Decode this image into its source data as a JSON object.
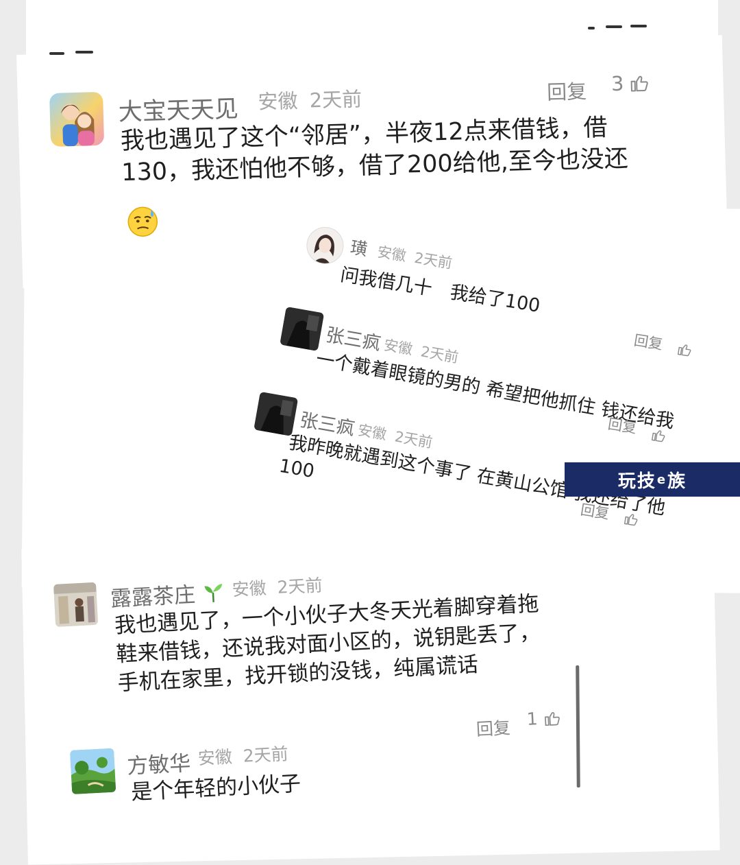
{
  "comments": [
    {
      "name": "大宝天天见",
      "region": "安徽",
      "time": "2天前",
      "text_lines": [
        "我也遇见了这个“邻居”，半夜12点来借钱，借",
        "130，我还怕他不够，借了200给他,至今也没还"
      ],
      "reply_label": "回复",
      "like_count": "3",
      "emoji": "anxious-sweat-emoji",
      "replies": [
        {
          "name": "璜",
          "region": "安徽",
          "time": "2天前",
          "text": "问我借几十　我给了100"
        },
        {
          "name": "张三疯",
          "region": "安徽",
          "time": "2天前",
          "text": "一个戴着眼镜的男的 希望把他抓住 钱还给我",
          "reply_label": "回复"
        },
        {
          "name": "张三疯",
          "region": "安徽",
          "time": "2天前",
          "text_lines": [
            "我昨晚就遇到这个事了 在黄山公馆 我还给了他",
            "100"
          ],
          "reply_label": "回复"
        }
      ],
      "trailing_reply_label": "回复"
    },
    {
      "name": "露露茶庄",
      "region": "安徽",
      "time": "2天前",
      "text_lines": [
        "我也遇见了，一个小伙子大冬天光着脚穿着拖",
        "鞋来借钱，还说我对面小区的，说钥匙丢了，",
        "手机在家里，找开锁的没钱，纯属谎话"
      ],
      "reply_label": "回复",
      "like_count": "1"
    },
    {
      "name": "方敏华",
      "region": "安徽",
      "time": "2天前",
      "text": "是个年轻的小伙子"
    }
  ],
  "watermark": {
    "part1": "玩技",
    "part2": "e",
    "part3": "族"
  },
  "colors": {
    "paper": "#ffffff",
    "background": "#ececec",
    "watermark_bg": "#1a2b66",
    "name": "#6e6e6e",
    "meta": "#a5a5a5"
  }
}
